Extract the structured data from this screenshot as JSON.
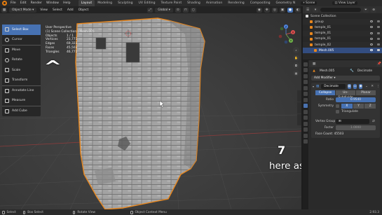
{
  "topbar": {
    "menus": [
      "File",
      "Edit",
      "Render",
      "Window",
      "Help"
    ],
    "workspaces": [
      "Layout",
      "Modeling",
      "Sculpting",
      "UV Editing",
      "Texture Paint",
      "Shading",
      "Animation",
      "Rendering",
      "Compositing",
      "Geometry N"
    ],
    "active_workspace": "Layout",
    "scene": "Scene",
    "view_layer": "View Layer"
  },
  "viewport_header": {
    "mode": "Object Mode",
    "menus": [
      "View",
      "Select",
      "Add",
      "Object"
    ],
    "orientation": "Global",
    "options": "Options"
  },
  "toolbar": {
    "tools": [
      "Select Box",
      "Cursor",
      "Move",
      "Rotate",
      "Scale",
      "Transform",
      "Annotate Line",
      "Measure",
      "Add Cube"
    ],
    "active": "Select Box"
  },
  "stats": {
    "title": "User Perspective",
    "collection": "(1) Scene Collection | Mesh.005",
    "rows": [
      {
        "label": "Objects",
        "value": "1 / 1"
      },
      {
        "label": "Vertices",
        "value": "23,771"
      },
      {
        "label": "Edges",
        "value": "69,322"
      },
      {
        "label": "Faces",
        "value": "45,503"
      },
      {
        "label": "Triangles",
        "value": "46,771"
      }
    ]
  },
  "annotation": {
    "caret": "^",
    "seven": "7",
    "here_text": "here as well"
  },
  "gizmo": {
    "x": "X",
    "y": "Y",
    "z": "Z"
  },
  "outliner": {
    "search_placeholder": "",
    "root": "Scene Collection",
    "items": [
      {
        "name": "group",
        "selected": false
      },
      {
        "name": "temple_01",
        "selected": false
      },
      {
        "name": "temple_01",
        "selected": false
      },
      {
        "name": "temple_01",
        "selected": false
      },
      {
        "name": "temple_02",
        "selected": false
      },
      {
        "name": "Mesh.005",
        "selected": true
      }
    ]
  },
  "properties": {
    "object_name": "Mesh.005",
    "modifier_name_right": "Decimate",
    "add_modifier": "Add Modifier",
    "modifier_title": "Decimate",
    "modes": [
      "Collapse",
      "Un-Subdivide",
      "Planar"
    ],
    "active_mode": "Collapse",
    "ratio_label": "Ratio",
    "ratio_value": "0.9540",
    "symmetry_label": "Symmetry",
    "symmetry_axes": [
      "X",
      "Y",
      "Z"
    ],
    "active_axis": "X",
    "triangulate": "Triangulate",
    "vertex_group_label": "Vertex Group",
    "factor_label": "Factor",
    "factor_value": "1.0000",
    "face_count": "Face Count: 45503"
  },
  "statusbar": {
    "select": "Select",
    "box_select": "Box Select",
    "rotate_view": "Rotate View",
    "context_menu": "Object Context Menu",
    "version": "2.93.3"
  },
  "colors": {
    "accent": "#4772b3",
    "selection_outline": "#e8871e",
    "mesh": "#9b9b9b"
  }
}
